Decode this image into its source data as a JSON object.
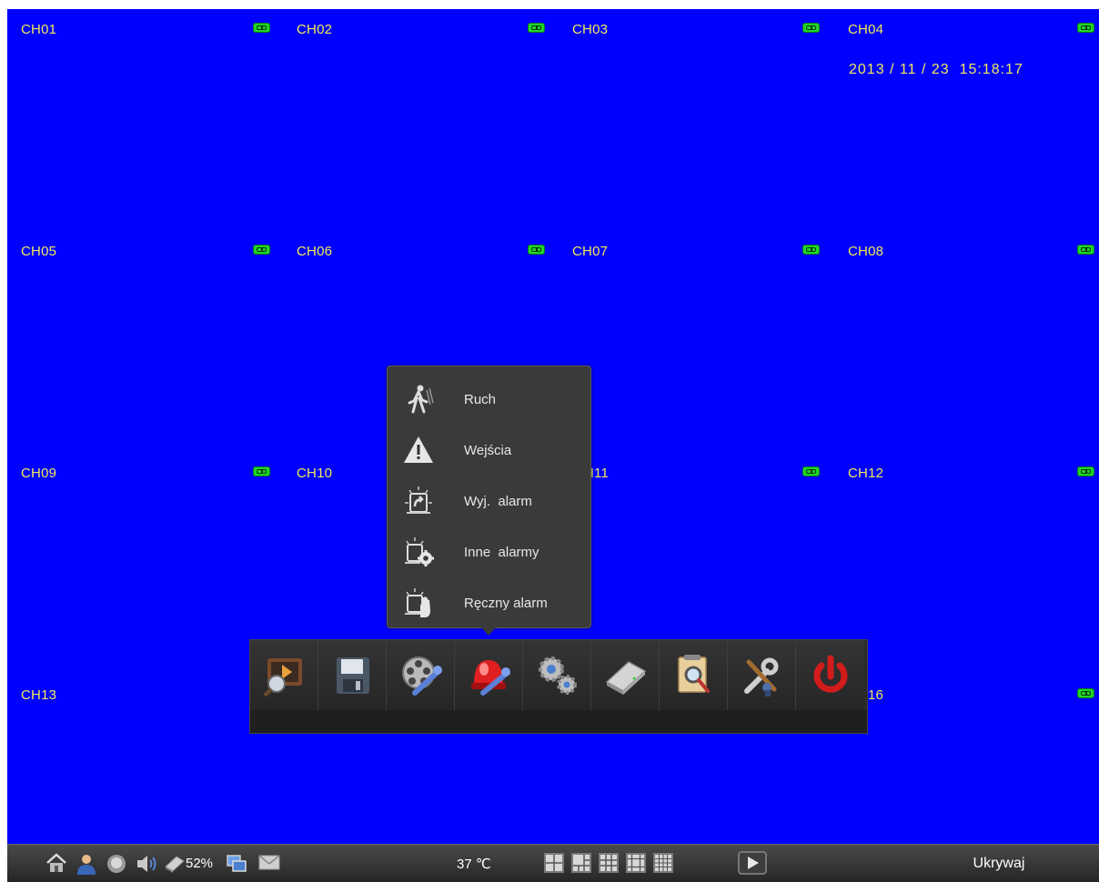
{
  "channels": [
    "CH01",
    "CH02",
    "CH03",
    "CH04",
    "CH05",
    "CH06",
    "CH07",
    "CH08",
    "CH09",
    "CH10",
    "H11",
    "CH12",
    "CH13",
    "",
    "",
    "16"
  ],
  "datetime": "2013 / 11 / 23  15:18:17",
  "alarm_menu": {
    "items": [
      {
        "label": "Ruch",
        "icon": "motion-icon"
      },
      {
        "label": "Wejścia",
        "icon": "warning-icon"
      },
      {
        "label": "Wyj.  alarm",
        "icon": "alarm-output-icon"
      },
      {
        "label": "Inne  alarmy",
        "icon": "other-alarms-icon"
      },
      {
        "label": "Ręczny alarm",
        "icon": "manual-alarm-icon"
      }
    ]
  },
  "toolbar": {
    "buttons": [
      {
        "name": "playback-search-button",
        "icon": "playback-search-icon"
      },
      {
        "name": "backup-button",
        "icon": "floppy-icon"
      },
      {
        "name": "record-settings-button",
        "icon": "film-reel-wrench-icon"
      },
      {
        "name": "alarm-settings-button",
        "icon": "alarm-wrench-icon"
      },
      {
        "name": "system-settings-button",
        "icon": "gears-icon"
      },
      {
        "name": "hdd-button",
        "icon": "hard-disk-icon"
      },
      {
        "name": "log-search-button",
        "icon": "log-search-icon"
      },
      {
        "name": "tools-button",
        "icon": "tools-icon"
      },
      {
        "name": "power-button",
        "icon": "power-icon"
      }
    ]
  },
  "statusbar": {
    "hdd_percent": "52%",
    "temperature": "37 ℃",
    "hide_label": "Ukrywaj",
    "icons": [
      "home-icon",
      "user-icon",
      "face-icon",
      "speaker-icon",
      "hdd-icon",
      "network-icon",
      "mail-icon"
    ],
    "layouts": [
      "layout-4-icon",
      "layout-6-icon",
      "layout-9-icon",
      "layout-13-icon",
      "layout-16-icon"
    ]
  },
  "colors": {
    "background": "#0000fe",
    "osd_text": "#f0e85a",
    "rec_green": "#1fd62a"
  }
}
